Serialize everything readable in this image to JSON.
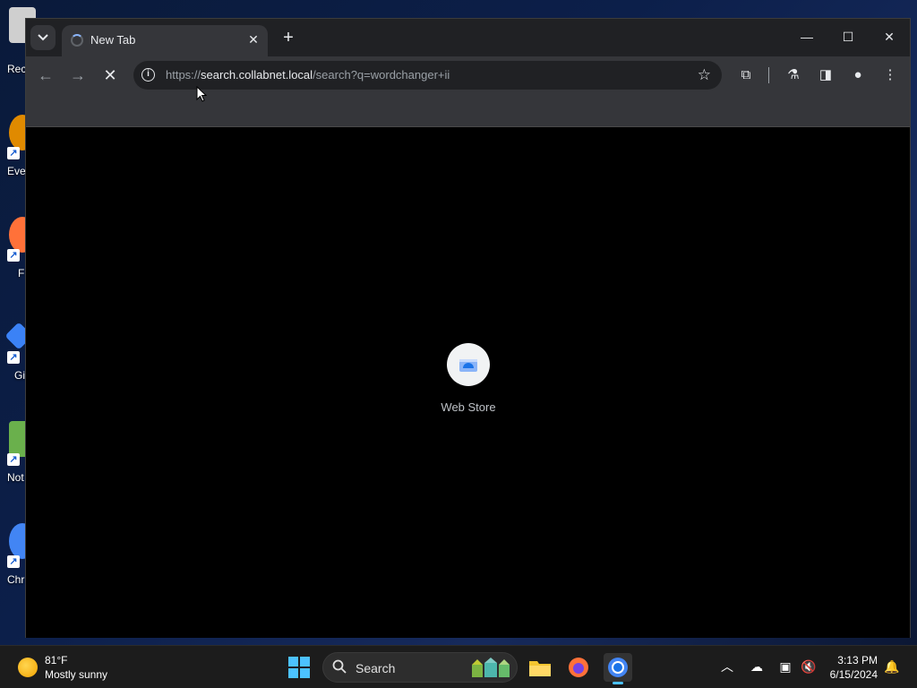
{
  "desktop": {
    "icons": [
      {
        "label": "Rec",
        "icon": "recycle-bin-icon",
        "color": "#d8d8d8"
      },
      {
        "label": "Eve",
        "icon": "everything-icon",
        "color": "#e08a00"
      },
      {
        "label": "F",
        "icon": "firefox-icon",
        "color": "#ff7139"
      },
      {
        "label": "Gi",
        "icon": "git-icon",
        "color": "#3b82f6"
      },
      {
        "label": "Not",
        "icon": "notepad-icon",
        "color": "#6ab04c"
      },
      {
        "label": "Chr",
        "icon": "chrome-icon",
        "color": "#4285f4"
      }
    ]
  },
  "browser": {
    "tab": {
      "title": "New Tab",
      "close_label": "✕"
    },
    "new_tab_label": "+",
    "window_controls": {
      "minimize": "—",
      "maximize": "☐",
      "close": "✕"
    },
    "toolbar": {
      "url_scheme": "https://",
      "url_host": "search.collabnet.local",
      "url_path": "/search?q=wordchanger+ii"
    },
    "content": {
      "shortcuts": [
        {
          "label": "Web Store",
          "icon": "web-store-icon"
        }
      ]
    }
  },
  "taskbar": {
    "weather": {
      "temp": "81°F",
      "desc": "Mostly sunny"
    },
    "search_placeholder": "Search",
    "clock": {
      "time": "3:13 PM",
      "date": "6/15/2024"
    }
  },
  "colors": {
    "accent": "#4cc2ff",
    "browser_chrome": "#35363a",
    "tab_strip": "#202124"
  }
}
